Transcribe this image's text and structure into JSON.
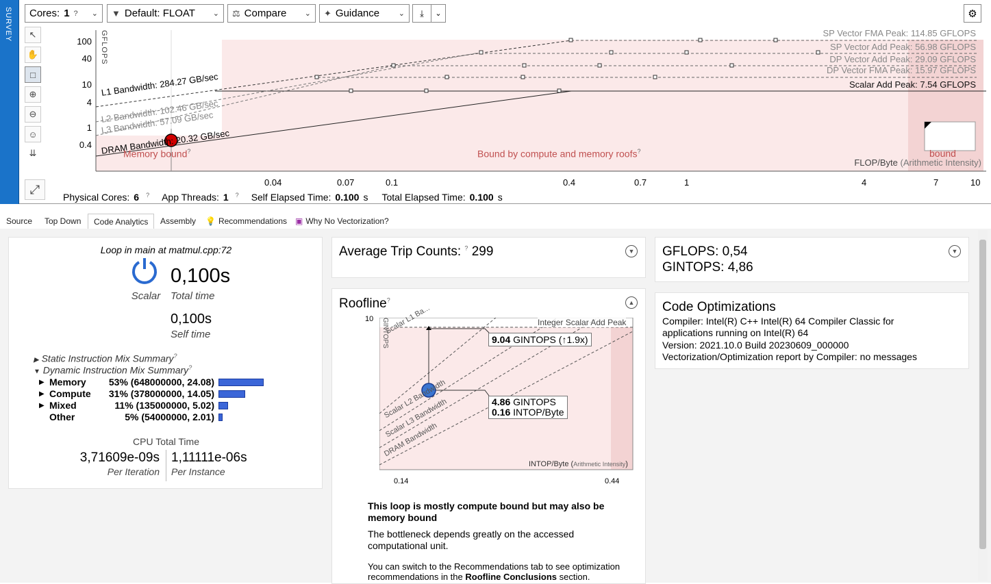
{
  "survey_label": "SURVEY",
  "toolbar": {
    "cores_label": "Cores:",
    "cores_value": "1",
    "filter_label": "Default: FLOAT",
    "compare_label": "Compare",
    "guidance_label": "Guidance"
  },
  "roofline_top": {
    "y_axis_label": "GFLOPS",
    "y_ticks": [
      "100",
      "40",
      "10",
      "4",
      "1",
      "0.4"
    ],
    "x_ticks": [
      "0.04",
      "0.07",
      "0.1",
      "0.4",
      "0.7",
      "1",
      "4",
      "7",
      "10"
    ],
    "x_axis_label": "FLOP/Byte",
    "x_axis_sub": "(Arithmetic Intensity)",
    "peaks": [
      "SP Vector FMA Peak: 114.85 GFLOPS",
      "SP Vector Add Peak: 56.98 GFLOPS",
      "DP Vector Add Peak: 29.09 GFLOPS",
      "DP Vector FMA Peak: 15.97 GFLOPS",
      "Scalar Add Peak: 7.54 GFLOPS"
    ],
    "bandwidths": [
      "L1 Bandwidth: 284.27 GB/sec",
      "L2 Bandwidth: 102.46 GB/sec",
      "L3 Bandwidth: 57.09 GB/sec",
      "DRAM Bandwidth: 20.32 GB/sec"
    ],
    "region_memory": "Memory bound",
    "region_both": "Bound by compute and memory roofs",
    "region_compute": "bound",
    "colors": {
      "region": "#fbe9e9",
      "region_dark": "#f3d3d3",
      "dot": "#d10000"
    }
  },
  "stats_bar": {
    "physical_cores_label": "Physical Cores:",
    "physical_cores_value": "6",
    "app_threads_label": "App Threads:",
    "app_threads_value": "1",
    "self_elapsed_label": "Self Elapsed Time:",
    "self_elapsed_value": "0.100",
    "self_elapsed_unit": "s",
    "total_elapsed_label": "Total Elapsed Time:",
    "total_elapsed_value": "0.100",
    "total_elapsed_unit": "s"
  },
  "tabs": [
    "Source",
    "Top Down",
    "Code Analytics",
    "Assembly",
    "Recommendations",
    "Why No Vectorization?"
  ],
  "loop_card": {
    "title": "Loop in main at matmul.cpp:72",
    "kind": "Scalar",
    "total_time": "0,100s",
    "total_time_label": "Total time",
    "self_time": "0,100s",
    "self_time_label": "Self time",
    "static_summary": "Static Instruction Mix Summary",
    "dynamic_summary": "Dynamic Instruction Mix Summary",
    "mix": [
      {
        "name": "Memory",
        "value": "53% (648000000, 24.08)",
        "pct": 53
      },
      {
        "name": "Compute",
        "value": "31% (378000000, 14.05)",
        "pct": 31
      },
      {
        "name": "Mixed",
        "value": "11% (135000000, 5.02)",
        "pct": 11
      },
      {
        "name": "Other",
        "value": "5% (54000000, 2.01)",
        "pct": 5
      }
    ],
    "cpu_total_label": "CPU Total Time",
    "per_iteration": "3,71609e-09s",
    "per_iteration_label": "Per Iteration",
    "per_instance": "1,11111e-06s",
    "per_instance_label": "Per Instance"
  },
  "trip_card": {
    "label": "Average Trip Counts:",
    "value": "299"
  },
  "roofline_card": {
    "title": "Roofline",
    "y_tick": "10",
    "y_label": "GINTOPS",
    "peak_label": "Integer Scalar Add Peak",
    "l1": "Scalar L1 Ba...",
    "l2": "Scalar L2 Bandwidth",
    "l3": "Scalar L3 Bandwidth",
    "dram": "DRAM Bandwidth",
    "callout_top_value": "9.04",
    "callout_top_text": "GINTOPS (↑1.9x)",
    "callout_bottom_value1": "4.86",
    "callout_bottom_text1": "GINTOPS",
    "callout_bottom_value2": "0.16",
    "callout_bottom_text2": "INTOP/Byte",
    "x_label": "INTOP/Byte",
    "x_label_sub": "Arithmetic Intensity",
    "x_ticks": [
      "0.14",
      "0.44"
    ],
    "conclusion_title": "This loop is mostly compute bound but may also be memory bound",
    "conclusion_text": "The bottleneck depends greatly on the accessed computational unit.",
    "switch_text": "You can switch to the Recommendations tab to see optimization recommendations in the",
    "switch_bold": "Roofline Conclusions",
    "switch_end": "section."
  },
  "gflops_card": {
    "gflops": "GFLOPS: 0,54",
    "gintops": "GINTOPS: 4,86"
  },
  "codeopt_card": {
    "title": "Code Optimizations",
    "compiler": "Compiler: Intel(R) C++ Intel(R) 64 Compiler Classic for applications running on Intel(R) 64",
    "version": "Version: 2021.10.0 Build 20230609_000000",
    "report": "Vectorization/Optimization report by Compiler: no messages"
  }
}
